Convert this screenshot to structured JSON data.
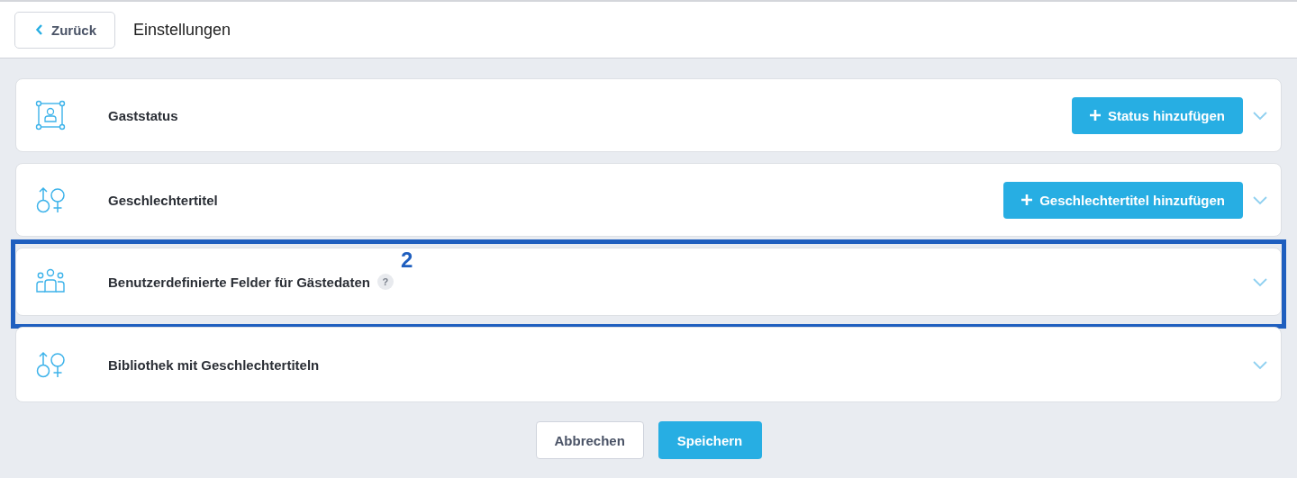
{
  "header": {
    "back_button": "Zurück",
    "title": "Einstellungen"
  },
  "sections": [
    {
      "kind": "status",
      "title": "Gaststatus",
      "add_button": "Status hinzufügen",
      "expanded": false,
      "highlighted": false
    },
    {
      "kind": "gender",
      "title": "Geschlechtertitel",
      "add_button": "Geschlechtertitel hinzufügen",
      "expanded": false,
      "highlighted": false
    },
    {
      "kind": "group",
      "title": "Benutzerdefinierte Felder für Gästedaten",
      "help": "?",
      "expanded": false,
      "highlighted": true,
      "callout": "2"
    },
    {
      "kind": "gender",
      "title": "Bibliothek mit Geschlechtertiteln",
      "expanded": false,
      "highlighted": false
    }
  ],
  "footer": {
    "cancel_button": "Abbrechen",
    "save_button": "Speichern"
  }
}
